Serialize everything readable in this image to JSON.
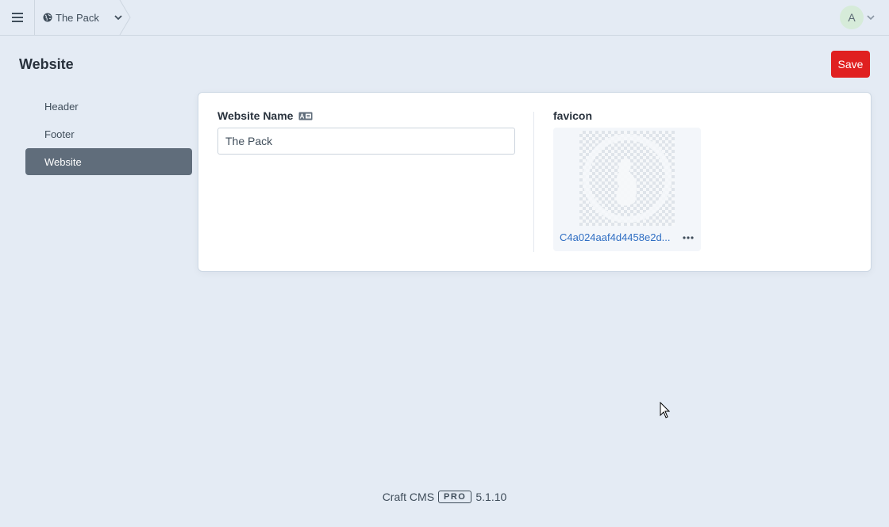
{
  "topbar": {
    "site_name": "The Pack",
    "icons": {
      "menu": "hamburger-icon",
      "site": "globe-icon",
      "site_switch": "chevron-down-icon",
      "user_menu": "chevron-down-icon"
    },
    "avatar_initial": "A"
  },
  "header": {
    "title": "Website",
    "save_label": "Save",
    "save_color": "#e02020"
  },
  "sidebar": {
    "items": [
      {
        "label": "Header",
        "active": false
      },
      {
        "label": "Footer",
        "active": false
      },
      {
        "label": "Website",
        "active": true
      }
    ]
  },
  "form": {
    "website_name": {
      "label": "Website Name",
      "label_icon": "translatable-icon",
      "value": "The Pack"
    },
    "favicon": {
      "label": "favicon",
      "filename": "C4a024aaf4d4458e2d...",
      "menu_icon": "ellipsis-icon"
    }
  },
  "footer": {
    "product": "Craft CMS",
    "edition": "PRO",
    "version": "5.1.10"
  }
}
